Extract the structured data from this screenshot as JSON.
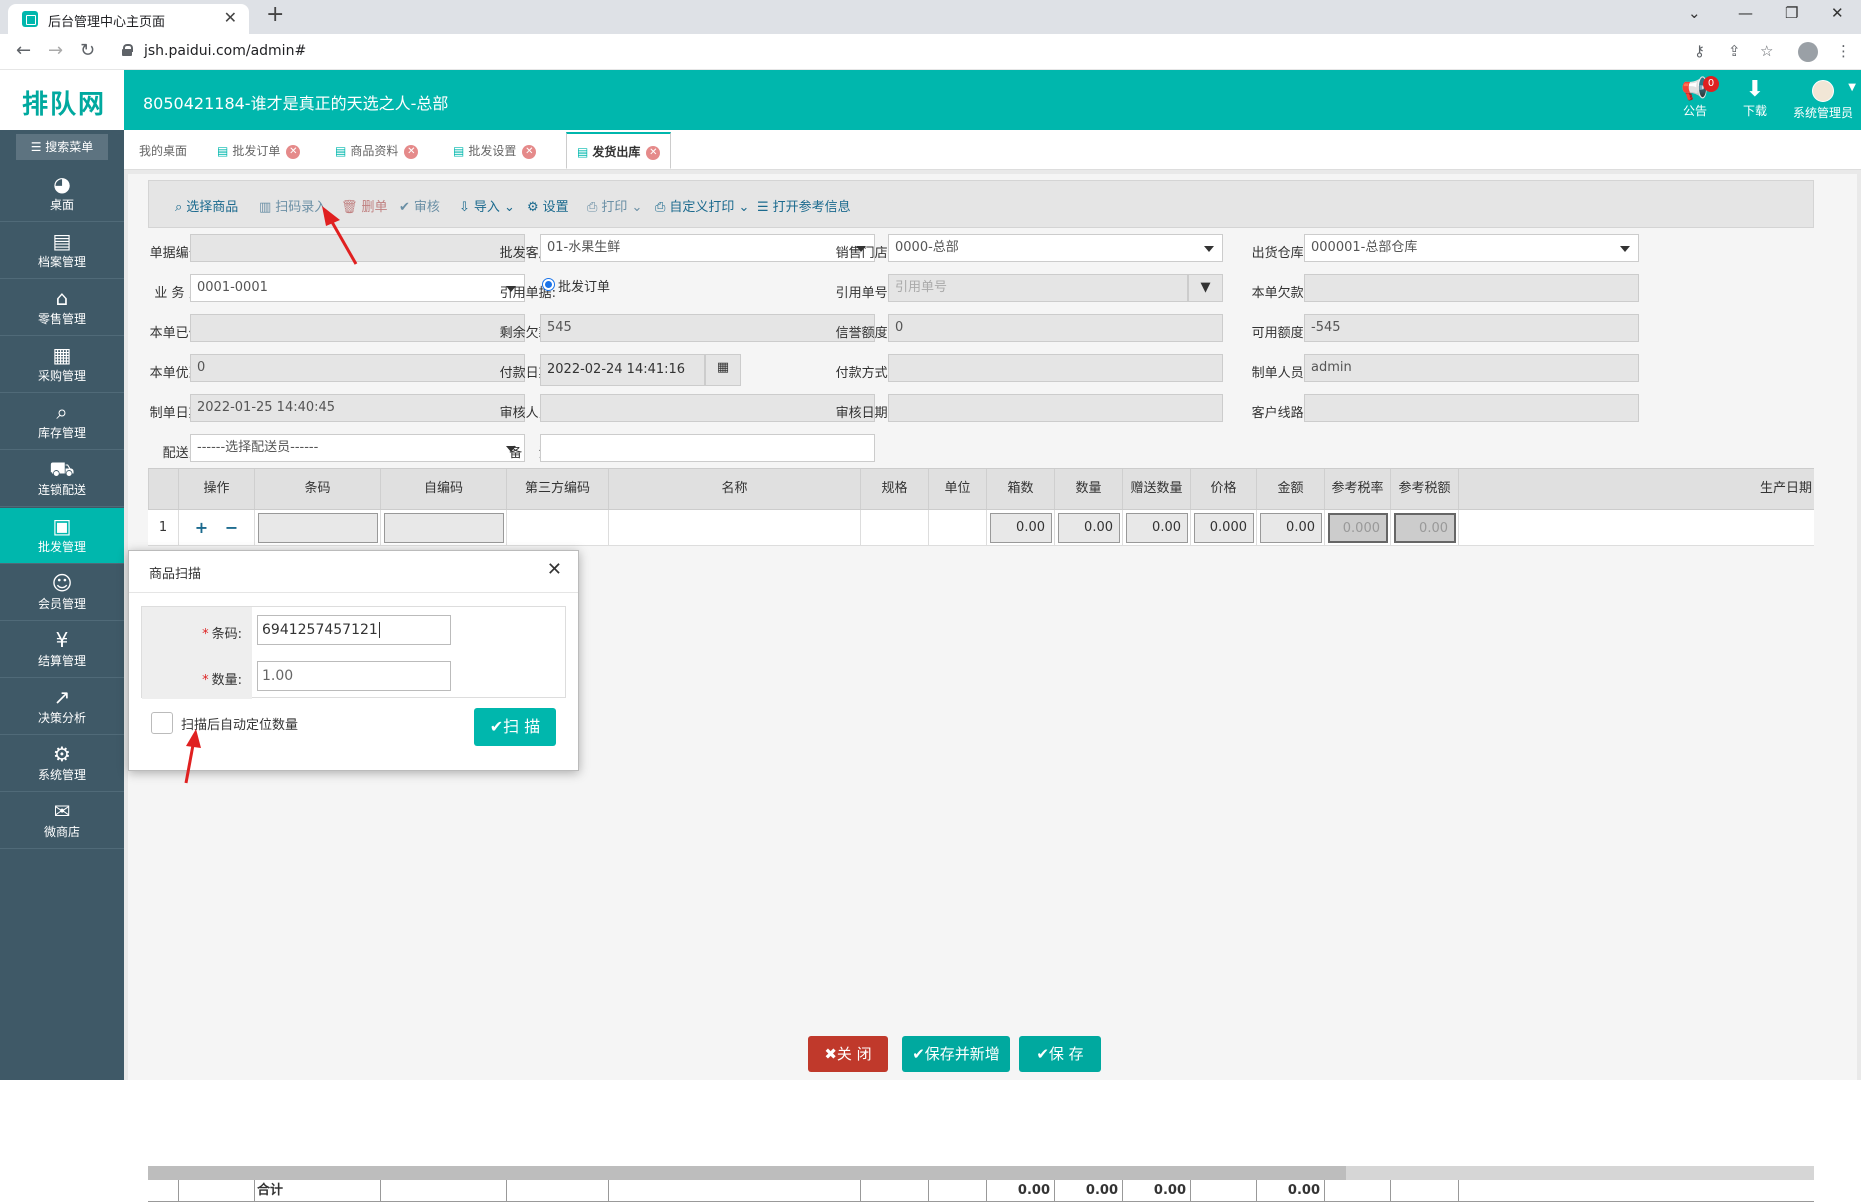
{
  "browser": {
    "tab_title": "后台管理中心主页面",
    "tab_close": "✕",
    "new_tab": "+",
    "url": "jsh.paidui.com/admin#",
    "win_min": "—",
    "win_restore": "❐",
    "win_close": "✕",
    "win_dropdown": "⌄"
  },
  "header": {
    "logo": "排队网",
    "company": "8050421184-谁才是真正的天选之人-总部",
    "notice_label": "公告",
    "notice_count": "0",
    "download_label": "下载",
    "user_label": "系统管理员"
  },
  "sidebar": {
    "search_label": "搜索菜单",
    "items": [
      {
        "label": "桌面",
        "icon": "dashboard-icon",
        "glyph": "◕"
      },
      {
        "label": "档案管理",
        "icon": "archive-icon",
        "glyph": "▤"
      },
      {
        "label": "零售管理",
        "icon": "store-icon",
        "glyph": "⌂"
      },
      {
        "label": "采购管理",
        "icon": "purchase-icon",
        "glyph": "▦"
      },
      {
        "label": "库存管理",
        "icon": "inventory-icon",
        "glyph": "⌕"
      },
      {
        "label": "连锁配送",
        "icon": "truck-icon",
        "glyph": "⛟"
      },
      {
        "label": "批发管理",
        "icon": "wholesale-icon",
        "glyph": "▣"
      },
      {
        "label": "会员管理",
        "icon": "member-icon",
        "glyph": "☺"
      },
      {
        "label": "结算管理",
        "icon": "settlement-icon",
        "glyph": "¥"
      },
      {
        "label": "决策分析",
        "icon": "analysis-icon",
        "glyph": "↗"
      },
      {
        "label": "系统管理",
        "icon": "settings-icon",
        "glyph": "⚙"
      },
      {
        "label": "微商店",
        "icon": "shop-icon",
        "glyph": "✉"
      }
    ]
  },
  "page_tabs": [
    {
      "label": "我的桌面"
    },
    {
      "label": "批发订单"
    },
    {
      "label": "商品资料"
    },
    {
      "label": "批发设置"
    },
    {
      "label": "发货出库"
    }
  ],
  "toolbar": {
    "select_goods": "选择商品",
    "scan_entry": "扫码录入",
    "delete": "删单",
    "audit": "审核",
    "import": "导入",
    "settings": "设置",
    "print": "打印",
    "custom_print": "自定义打印",
    "open_ref": "打开参考信息"
  },
  "form": {
    "doc_no_label": "单据编号:",
    "doc_no": "",
    "customer_label": "批发客户:",
    "customer": "01-水果生鲜",
    "store_label": "销售门店:",
    "store": "0000-总部",
    "warehouse_label": "出货仓库:",
    "warehouse": "000001-总部仓库",
    "salesman_label": "业 务 员:",
    "salesman": "0001-0001",
    "ref_doc_label": "引用单据:",
    "ref_doc_option": "批发订单",
    "ref_no_label": "引用单号:",
    "ref_no_placeholder": "引用单号",
    "owed_label": "本单欠款:",
    "owed": "",
    "paid_label": "本单已付:",
    "paid": "",
    "remain_label": "剩余欠款:",
    "remain": "545",
    "credit_label": "信誉额度:",
    "credit": "0",
    "available_label": "可用额度:",
    "available": "-545",
    "discount_label": "本单优惠:",
    "discount": "0",
    "pay_date_label": "付款日期:",
    "pay_date": "2022-02-24 14:41:16",
    "pay_method_label": "付款方式:",
    "pay_method": "",
    "maker_label": "制单人员:",
    "maker": "admin",
    "make_date_label": "制单日期:",
    "make_date": "2022-01-25 14:40:45",
    "auditor_label": "审核人员:",
    "auditor": "",
    "audit_date_label": "审核日期:",
    "audit_date": "",
    "route_label": "客户线路:",
    "route": "",
    "deliverer_label": "配送员:",
    "deliverer": "------选择配送员------",
    "remark_label": "备    注:",
    "remark": ""
  },
  "grid": {
    "headers": [
      "操作",
      "条码",
      "自编码",
      "第三方编码",
      "名称",
      "规格",
      "单位",
      "箱数",
      "数量",
      "赠送数量",
      "价格",
      "金额",
      "参考税率",
      "参考税额",
      "生产日期"
    ],
    "row_no": "1",
    "row_add": "+",
    "row_remove": "−",
    "row_values": {
      "boxes": "0.00",
      "qty": "0.00",
      "gift": "0.00",
      "price": "0.000",
      "amount": "0.00",
      "tax_rate": "0.000",
      "tax": "0.00"
    },
    "footer_label": "合计",
    "footer_boxes": "0.00",
    "footer_qty": "0.00",
    "footer_gift": "0.00",
    "footer_amount": "0.00"
  },
  "buttons": {
    "close": "✖关 闭",
    "save_new": "✔保存并新增",
    "save": "✔保 存"
  },
  "modal": {
    "title": "商品扫描",
    "close": "✕",
    "barcode_label": "条码:",
    "barcode": "6941257457121",
    "qty_label": "数量:",
    "qty": "1.00",
    "auto_locate_label": "扫描后自动定位数量",
    "scan_button": "✔扫 描"
  },
  "colors": {
    "primary": "#00b7ad",
    "sidebar": "#3f5967",
    "danger": "#c0392b",
    "annotation": "#e02020"
  }
}
